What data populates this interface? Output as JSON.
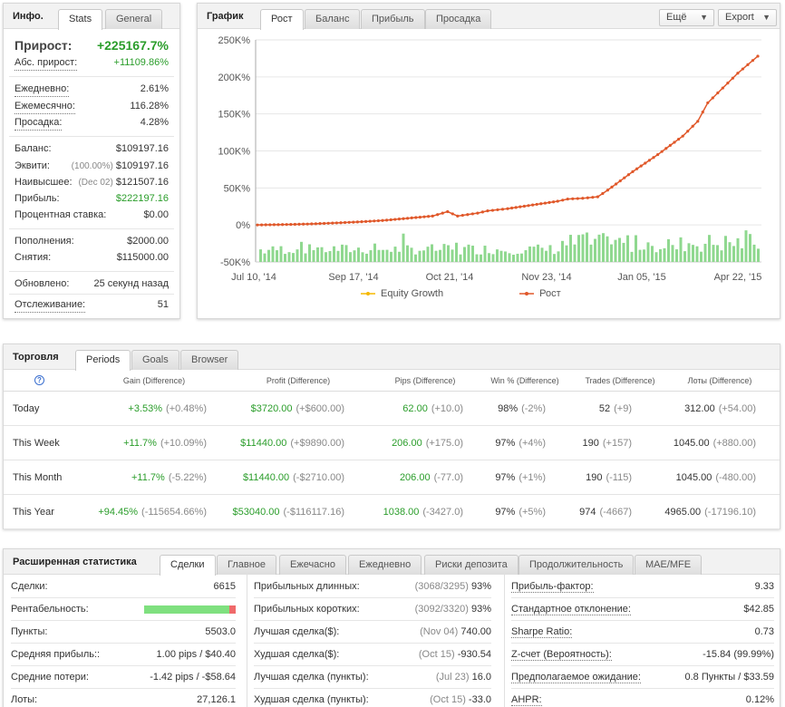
{
  "info": {
    "title": "Инфо.",
    "tabs": [
      "Stats",
      "General"
    ],
    "growth_label": "Прирост:",
    "growth_value": "+225167.7%",
    "abs_growth_label": "Абс. прирост:",
    "abs_growth_value": "+11109.86%",
    "daily_label": "Ежедневно:",
    "daily_value": "2.61%",
    "monthly_label": "Ежемесячно:",
    "monthly_value": "116.28%",
    "drawdown_label": "Просадка:",
    "drawdown_value": "4.28%",
    "balance_label": "Баланс:",
    "balance_value": "$109197.16",
    "equity_label": "Эквити:",
    "equity_pct": "(100.00%)",
    "equity_value": "$109197.16",
    "highest_label": "Наивысшее:",
    "highest_date": "(Dec 02)",
    "highest_value": "$121507.16",
    "profit_label": "Прибыль:",
    "profit_value": "$222197.16",
    "interest_label": "Процентная ставка:",
    "interest_value": "$0.00",
    "deposits_label": "Пополнения:",
    "deposits_value": "$2000.00",
    "withdrawals_label": "Снятия:",
    "withdrawals_value": "$115000.00",
    "updated_label": "Обновлено:",
    "updated_value": "25 секунд назад",
    "tracking_label": "Отслеживание:",
    "tracking_value": "51"
  },
  "graph": {
    "title": "График",
    "tabs": [
      "Рост",
      "Баланс",
      "Прибыль",
      "Просадка"
    ],
    "more_label": "Ещё",
    "export_label": "Export",
    "legend": [
      "Equity Growth",
      "Рост"
    ],
    "colors": {
      "growth": "#e0582a",
      "equity": "#f5b800",
      "bars": "#8fd88f"
    }
  },
  "chart_data": {
    "type": "line",
    "x_ticks": [
      "Jul 10, '14",
      "Sep 17, '14",
      "Oct 21, '14",
      "Nov 23, '14",
      "Jan 05, '15",
      "Apr 22, '15"
    ],
    "y_ticks": [
      "250K%",
      "200K%",
      "150K%",
      "100K%",
      "50K%",
      "0%",
      "-50K%"
    ],
    "ylim": [
      -50000,
      250000
    ],
    "series": [
      {
        "name": "Рост",
        "x_fraction_of_period": [
          0,
          0.05,
          0.1,
          0.15,
          0.2,
          0.25,
          0.3,
          0.35,
          0.38,
          0.39,
          0.4,
          0.42,
          0.44,
          0.46,
          0.5,
          0.55,
          0.6,
          0.62,
          0.65,
          0.68,
          0.7,
          0.75,
          0.8,
          0.85,
          0.88,
          0.9,
          0.93,
          0.96,
          1.0
        ],
        "values": [
          0,
          500,
          1200,
          2500,
          4000,
          6000,
          9000,
          12000,
          18000,
          15000,
          12000,
          14000,
          16000,
          19000,
          22000,
          27000,
          32000,
          35000,
          36000,
          38000,
          47000,
          72000,
          95000,
          120000,
          140000,
          165000,
          185000,
          205000,
          228000
        ]
      }
    ],
    "grid": true,
    "legend_position": "bottom"
  },
  "trading": {
    "title": "Торговля",
    "tabs": [
      "Periods",
      "Goals",
      "Browser"
    ],
    "help_icon": "?",
    "headers": [
      "Gain (Difference)",
      "Profit (Difference)",
      "Pips (Difference)",
      "Win % (Difference)",
      "Trades (Difference)",
      "Лоты (Difference)"
    ],
    "rows": [
      {
        "period": "Today",
        "gain": "+3.53%",
        "gain_diff": "(+0.48%)",
        "profit": "$3720.00",
        "profit_diff": "(+$600.00)",
        "pips": "62.00",
        "pips_diff": "(+10.0)",
        "win": "98%",
        "win_diff": "(-2%)",
        "trades": "52",
        "trades_diff": "(+9)",
        "lots": "312.00",
        "lots_diff": "(+54.00)"
      },
      {
        "period": "This Week",
        "gain": "+11.7%",
        "gain_diff": "(+10.09%)",
        "profit": "$11440.00",
        "profit_diff": "(+$9890.00)",
        "pips": "206.00",
        "pips_diff": "(+175.0)",
        "win": "97%",
        "win_diff": "(+4%)",
        "trades": "190",
        "trades_diff": "(+157)",
        "lots": "1045.00",
        "lots_diff": "(+880.00)"
      },
      {
        "period": "This Month",
        "gain": "+11.7%",
        "gain_diff": "(-5.22%)",
        "profit": "$11440.00",
        "profit_diff": "(-$2710.00)",
        "pips": "206.00",
        "pips_diff": "(-77.0)",
        "win": "97%",
        "win_diff": "(+1%)",
        "trades": "190",
        "trades_diff": "(-115)",
        "lots": "1045.00",
        "lots_diff": "(-480.00)"
      },
      {
        "period": "This Year",
        "gain": "+94.45%",
        "gain_diff": "(-115654.66%)",
        "profit": "$53040.00",
        "profit_diff": "(-$116117.16)",
        "pips": "1038.00",
        "pips_diff": "(-3427.0)",
        "win": "97%",
        "win_diff": "(+5%)",
        "trades": "974",
        "trades_diff": "(-4667)",
        "lots": "4965.00",
        "lots_diff": "(-17196.10)"
      }
    ]
  },
  "extended": {
    "title": "Расширенная статистика",
    "tabs": [
      "Сделки",
      "Главное",
      "Ежечасно",
      "Ежедневно",
      "Риски депозита",
      "Продолжительность",
      "MAE/MFE"
    ],
    "col1": [
      {
        "label": "Сделки:",
        "value": "6615"
      },
      {
        "label": "Рентабельность:",
        "value": ""
      },
      {
        "label": "Пункты:",
        "value": "5503.0"
      },
      {
        "label": "Средняя прибыль::",
        "value": "1.00 pips / $40.40"
      },
      {
        "label": "Средние потери:",
        "value": "-1.42 pips / -$58.64"
      },
      {
        "label": "Лоты:",
        "value": "27,126.1"
      }
    ],
    "profitability_fraction": 0.93,
    "col2": [
      {
        "label": "Прибыльных длинных:",
        "detail": "(3068/3295)",
        "value": "93%"
      },
      {
        "label": "Прибыльных коротких:",
        "detail": "(3092/3320)",
        "value": "93%"
      },
      {
        "label": "Лучшая сделка($):",
        "detail": "(Nov 04)",
        "value": "740.00"
      },
      {
        "label": "Худшая сделка($):",
        "detail": "(Oct 15)",
        "value": "-930.54"
      },
      {
        "label": "Лучшая сделка (пункты):",
        "detail": "(Jul 23)",
        "value": "16.0"
      },
      {
        "label": "Худшая сделка (пункты):",
        "detail": "(Oct 15)",
        "value": "-33.0"
      }
    ],
    "col3": [
      {
        "label": "Прибыль-фактор:",
        "value": "9.33"
      },
      {
        "label": "Стандартное отклонение:",
        "value": "$42.85"
      },
      {
        "label": "Sharpe Ratio:",
        "value": "0.73"
      },
      {
        "label": "Z-счет (Вероятность):",
        "value": "-15.84 (99.99%)"
      },
      {
        "label": "Предполагаемое ожидание:",
        "value": "0.8 Пункты / $33.59"
      },
      {
        "label": "AHPR:",
        "value": "0.12%"
      }
    ]
  }
}
